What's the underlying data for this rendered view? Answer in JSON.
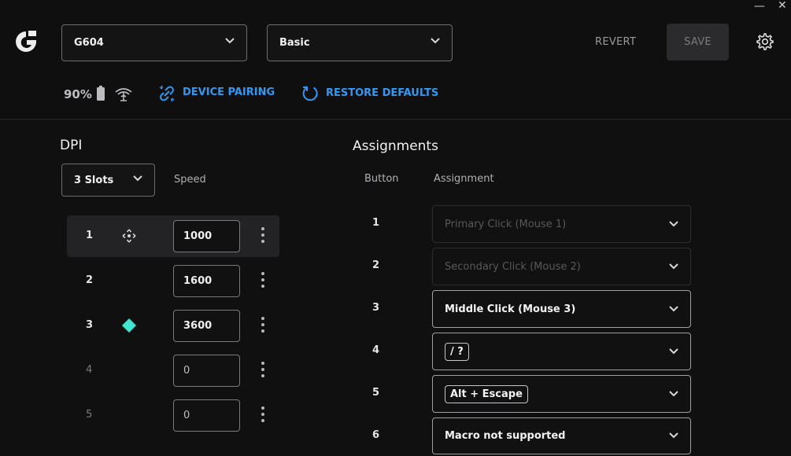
{
  "window": {
    "minimize_glyph": "—",
    "close_glyph": "✕"
  },
  "header": {
    "device": {
      "value": "G604"
    },
    "profile": {
      "value": "Basic"
    },
    "revert_label": "REVERT",
    "save_label": "SAVE"
  },
  "status": {
    "battery_pct": "90%",
    "device_pairing_label": "DEVICE PAIRING",
    "restore_defaults_label": "RESTORE DEFAULTS"
  },
  "dpi": {
    "title": "DPI",
    "slots_select": "3 Slots",
    "speed_label": "Speed",
    "slots": [
      {
        "num": "1",
        "value": "1000",
        "active": true,
        "indicator": "move-icon"
      },
      {
        "num": "2",
        "value": "1600"
      },
      {
        "num": "3",
        "value": "3600",
        "indicator": "diamond-icon"
      },
      {
        "num": "4",
        "value": "0",
        "disabled": true
      },
      {
        "num": "5",
        "value": "0",
        "disabled": true
      }
    ]
  },
  "assignments": {
    "title": "Assignments",
    "col_button": "Button",
    "col_assignment": "Assignment",
    "rows": [
      {
        "button": "1",
        "assignment": "Primary Click (Mouse 1)",
        "disabled": true
      },
      {
        "button": "2",
        "assignment": "Secondary Click (Mouse 2)",
        "disabled": true
      },
      {
        "button": "3",
        "assignment": "Middle Click (Mouse 3)"
      },
      {
        "button": "4",
        "assignment": "/ ?",
        "keycap": true
      },
      {
        "button": "5",
        "assignment": "Alt + Escape",
        "keycap": true
      },
      {
        "button": "6",
        "assignment": "Macro not supported"
      }
    ]
  },
  "colors": {
    "accent_blue": "#2f9af5",
    "dpi_indicator": "#3ee6cf",
    "background": "#101011"
  }
}
